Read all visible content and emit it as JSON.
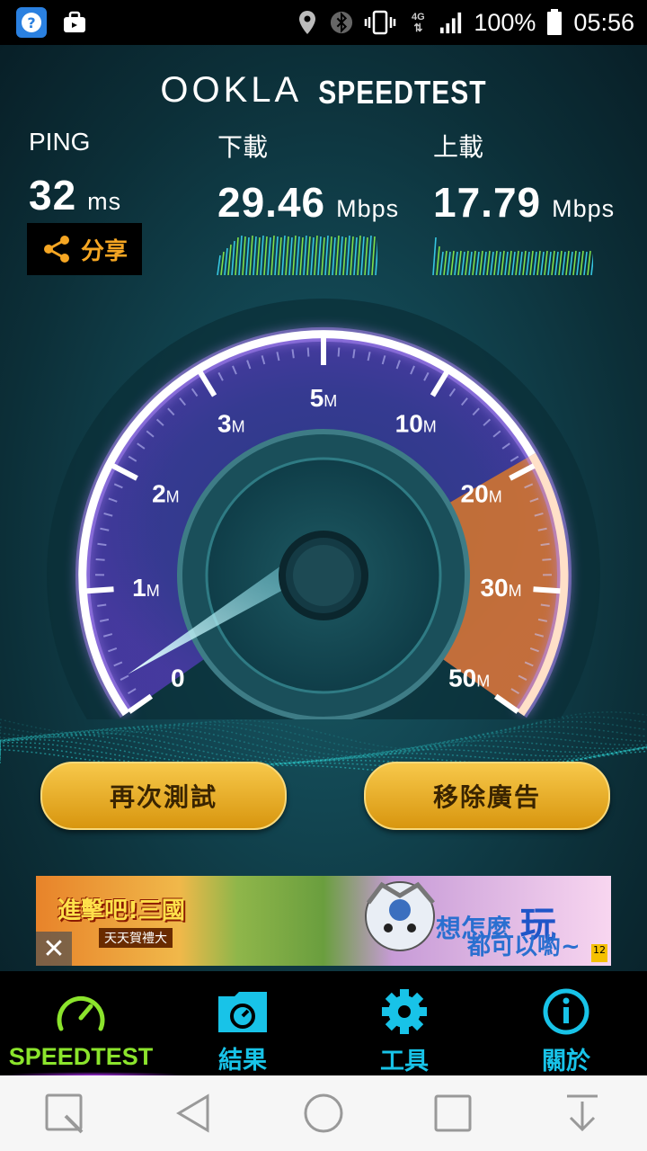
{
  "status_bar": {
    "battery": "100%",
    "time": "05:56",
    "network": "4G",
    "icons": [
      "help-app-icon",
      "briefcase-icon",
      "location-icon",
      "bluetooth-icon",
      "vibrate-icon",
      "network-4g-icon",
      "signal-icon",
      "battery-icon"
    ]
  },
  "header": {
    "brand": "OOKLA",
    "product": "SPEEDTEST"
  },
  "results": {
    "ping": {
      "label": "PING",
      "value": "32",
      "unit": "ms"
    },
    "download": {
      "label": "下載",
      "value": "29.46",
      "unit": "Mbps"
    },
    "upload": {
      "label": "上載",
      "value": "17.79",
      "unit": "Mbps"
    }
  },
  "share": {
    "label": "分享"
  },
  "gauge": {
    "ticks": [
      {
        "n": "0",
        "u": ""
      },
      {
        "n": "1",
        "u": "M"
      },
      {
        "n": "2",
        "u": "M"
      },
      {
        "n": "3",
        "u": "M"
      },
      {
        "n": "5",
        "u": "M"
      },
      {
        "n": "10",
        "u": "M"
      },
      {
        "n": "20",
        "u": "M"
      },
      {
        "n": "30",
        "u": "M"
      },
      {
        "n": "50",
        "u": "M"
      }
    ]
  },
  "buttons": {
    "retest": "再次測試",
    "remove_ads": "移除廣告"
  },
  "ad": {
    "title": "進擊吧!三國",
    "subtitle": "天天賀禮大",
    "line1_a": "想怎麼",
    "line1_b": "玩",
    "line2": "都可以喲~",
    "close": "✕",
    "rating": "12"
  },
  "tabs": [
    {
      "label": "SPEEDTEST",
      "icon": "speedometer-icon",
      "color": "#8be42c"
    },
    {
      "label": "結果",
      "icon": "results-folder-icon",
      "color": "#18c3e8"
    },
    {
      "label": "工具",
      "icon": "gear-icon",
      "color": "#18c3e8"
    },
    {
      "label": "關於",
      "icon": "info-icon",
      "color": "#18c3e8"
    }
  ],
  "nav": [
    "recent-apps-q-icon",
    "back-icon",
    "home-icon",
    "overview-icon",
    "notification-pull-icon"
  ],
  "colors": {
    "accent_orange": "#f5a623",
    "speedtest_green": "#8be42c",
    "tab_cyan": "#18c3e8",
    "gauge_purple": "#8a5cf0"
  }
}
